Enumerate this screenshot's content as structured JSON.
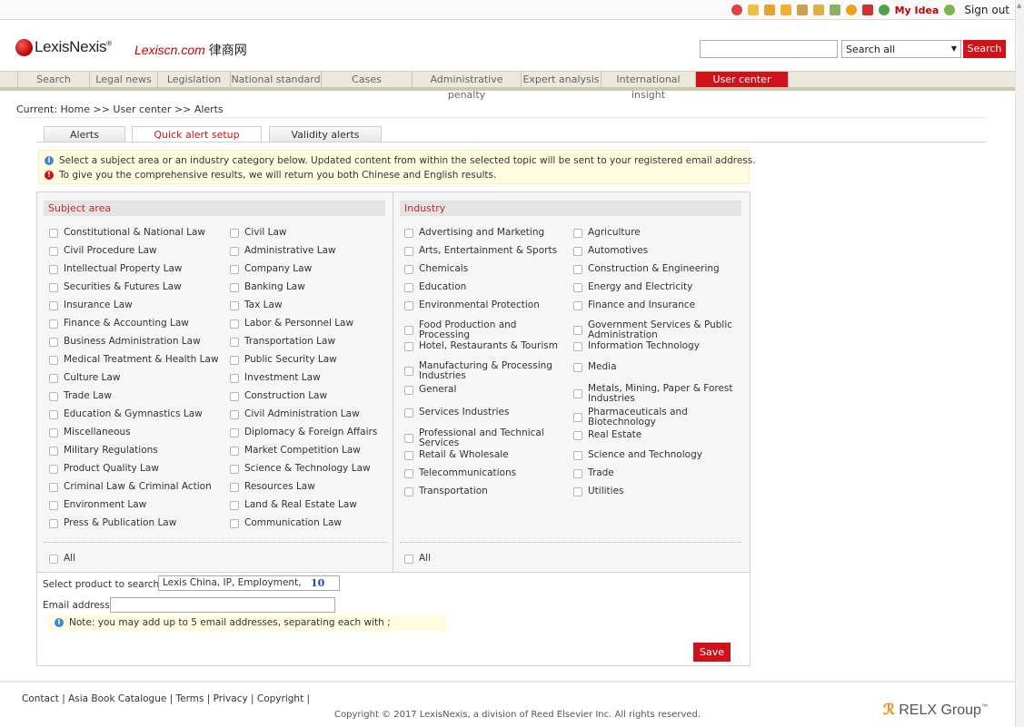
{
  "topbar": {
    "my_idea": "My Idea",
    "sign_out": "Sign out",
    "icons": [
      "red-circle-icon",
      "list-icon",
      "home-icon",
      "monitor-icon",
      "people-icon",
      "user-icon",
      "grid-icon",
      "bell-icon",
      "cn-icon",
      "globe-icon",
      "help-icon"
    ]
  },
  "header": {
    "brand": "LexisNexis",
    "site": "Lexiscn.com",
    "site_cn": "律商网",
    "search_scope": "Search all",
    "search_button": "Search"
  },
  "nav": [
    "Search",
    "Legal news",
    "Legislation",
    "National standard",
    "Cases",
    "Administrative penalty",
    "Expert analysis",
    "International insight",
    "User center"
  ],
  "breadcrumb": "Current: Home >> User center >> Alerts",
  "tabs": [
    "Alerts",
    "Quick alert setup",
    "Validity alerts"
  ],
  "notices": [
    "Select a subject area or an industry category below. Updated content from within the selected topic will be sent to your registered email address.",
    "To give you the comprehensive results, we will return you both Chinese and English results."
  ],
  "subject": {
    "title": "Subject area",
    "col1": [
      "Constitutional & National Law",
      "Civil Procedure Law",
      "Intellectual Property Law",
      "Securities & Futures Law",
      "Insurance Law",
      "Finance & Accounting Law",
      "Business Administration Law",
      "Medical Treatment & Health Law",
      "Culture Law",
      "Trade Law",
      "Education & Gymnastics Law",
      "Miscellaneous",
      "Military Regulations",
      "Product Quality Law",
      "Criminal Law & Criminal Action",
      "Environment Law",
      "Press & Publication Law"
    ],
    "col2": [
      "Civil Law",
      "Administrative Law",
      "Company Law",
      "Banking Law",
      "Tax Law",
      "Labor & Personnel Law",
      "Transportation Law",
      "Public Security Law",
      "Investment Law",
      "Construction Law",
      "Civil Administration Law",
      "Diplomacy & Foreign Affairs",
      "Market Competition Law",
      "Science & Technology Law",
      "Resources Law",
      "Land & Real Estate Law",
      "Communication Law"
    ],
    "all": "All"
  },
  "industry": {
    "title": "Industry",
    "col1": [
      "Advertising and Marketing",
      "Arts, Entertainment & Sports",
      "Chemicals",
      "Education",
      "Environmental Protection",
      "Food Production and Processing",
      "Hotel, Restaurants & Tourism",
      "Manufacturing & Processing Industries",
      "General",
      "Services Industries",
      "Professional and Technical Services",
      "Retail & Wholesale",
      "Telecommunications",
      "Transportation"
    ],
    "col2": [
      "Agriculture",
      "Automotives",
      "Construction & Engineering",
      "Energy and Electricity",
      "Finance and Insurance",
      "Government Services & Public Administration",
      "Information Technology",
      "Media",
      "Metals, Mining, Paper & Forest Industries",
      "Pharmaceuticals and Biotechnology",
      "Real Estate",
      "Science and Technology",
      "Trade",
      "Utilities"
    ],
    "all": "All"
  },
  "form": {
    "product_label": "Select product to search :",
    "product_value": "Lexis China, IP, Employment,",
    "product_count": "10",
    "email_label": "Email address:",
    "note": "Note: you may add up to 5 email addresses, separating each with ;",
    "save": "Save"
  },
  "footer": {
    "links": "Contact | Asia Book Catalogue | Terms | Privacy | Copyright |",
    "copyright": "Copyright © 2017 LexisNexis, a division of Reed Elsevier Inc. All rights reserved.",
    "relx": "RELX Group"
  }
}
